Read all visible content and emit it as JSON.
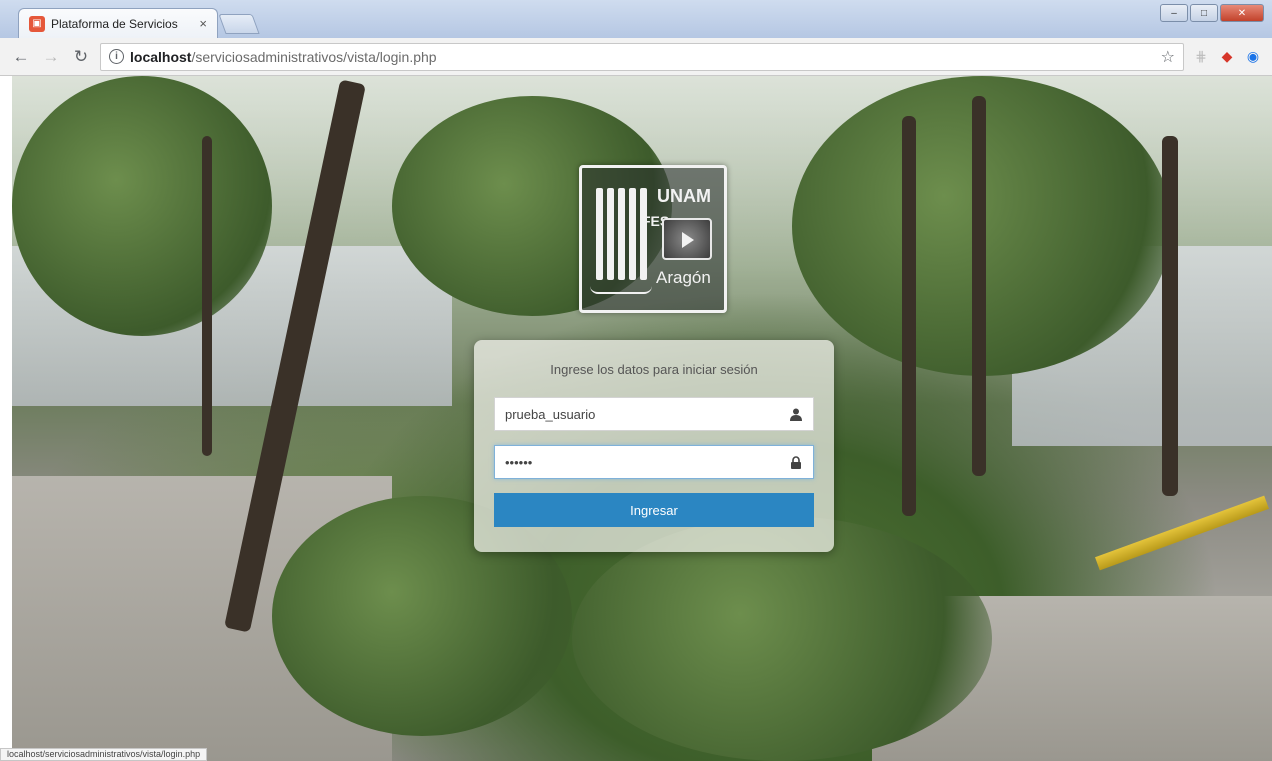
{
  "browser": {
    "tab_title": "Plataforma de Servicios",
    "tab_close": "×",
    "url_host": "localhost",
    "url_path": "/serviciosadministrativos/vista/login.php",
    "status_url": "localhost/serviciosadministrativos/vista/login.php"
  },
  "logo": {
    "unam": "UNAM",
    "fes": "FES",
    "campus": "Aragón"
  },
  "login": {
    "prompt": "Ingrese los datos para iniciar sesión",
    "username_value": "prueba_usuario",
    "password_value": "••••••",
    "submit_label": "Ingresar"
  },
  "icons": {
    "back": "back-arrow-icon",
    "forward": "forward-arrow-icon",
    "reload": "reload-icon",
    "info": "info-icon",
    "star": "bookmark-star-icon",
    "user": "user-icon",
    "lock": "lock-icon"
  },
  "colors": {
    "submit_button": "#2b86c2",
    "focus_border": "#7fb1d9"
  }
}
